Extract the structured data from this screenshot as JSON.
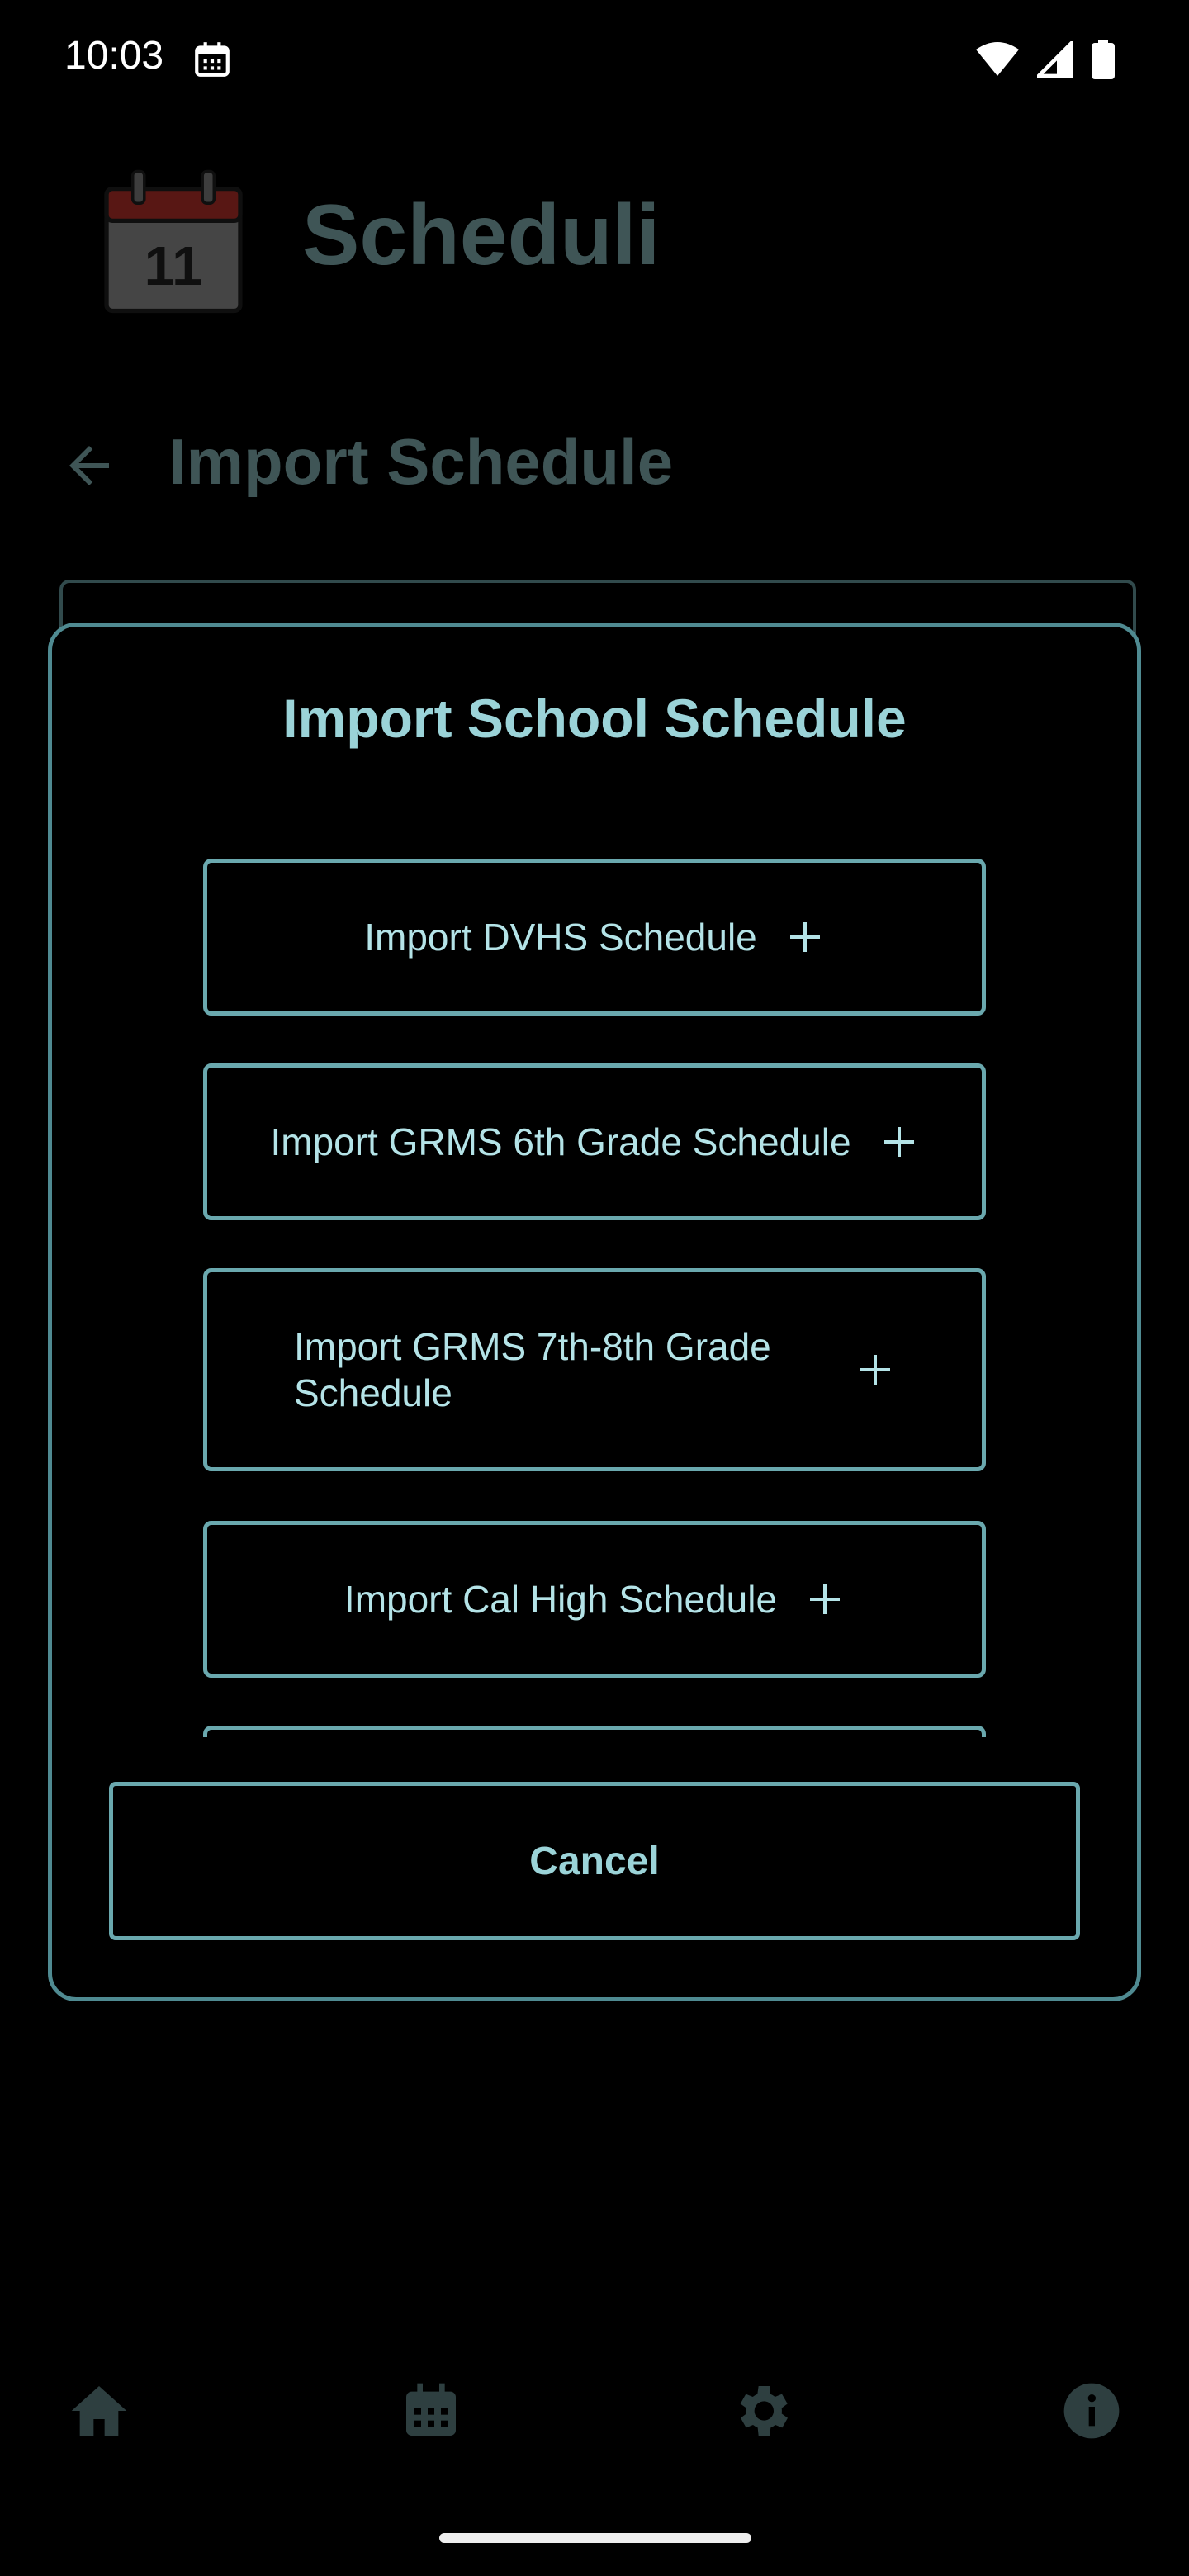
{
  "status_bar": {
    "time": "10:03",
    "icons": [
      "calendar-icon",
      "wifi-icon",
      "signal-icon",
      "battery-icon"
    ]
  },
  "app": {
    "title": "Scheduli",
    "icon_text": "11"
  },
  "page": {
    "title": "Import Schedule"
  },
  "dialog": {
    "title": "Import School Schedule",
    "options": [
      {
        "label": "Import DVHS Schedule"
      },
      {
        "label": "Import GRMS 6th Grade Schedule"
      },
      {
        "label": "Import GRMS 7th-8th Grade Schedule"
      },
      {
        "label": "Import Cal High Schedule"
      }
    ],
    "cancel_label": "Cancel"
  },
  "bottom_nav": {
    "items": [
      "home-icon",
      "calendar-icon",
      "settings-icon",
      "info-icon"
    ]
  },
  "colors": {
    "accent": "#6aa8ae",
    "title_text": "#9bd3d8",
    "background": "#000000",
    "dimmed": "#3f5556"
  }
}
